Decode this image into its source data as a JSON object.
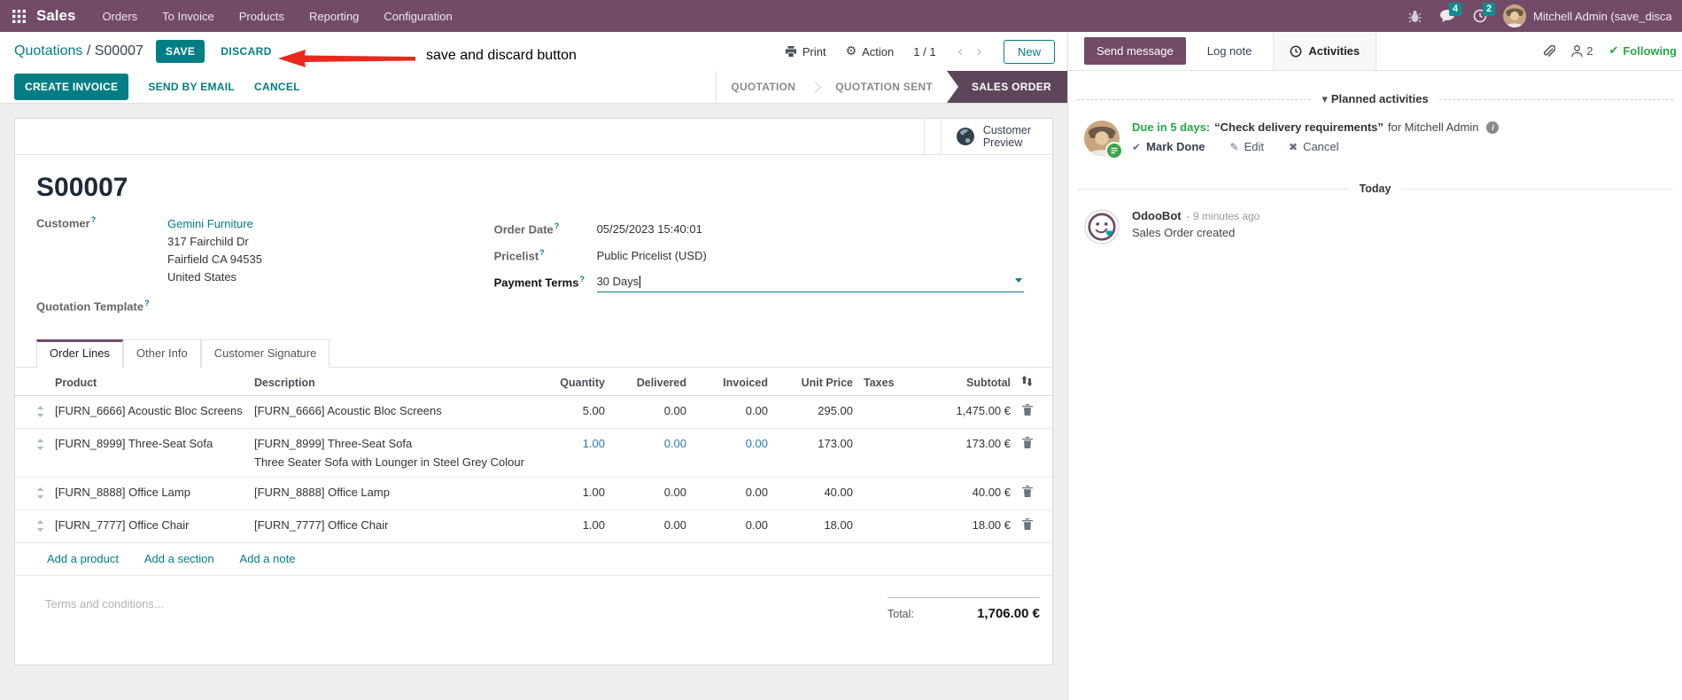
{
  "topbar": {
    "app_name": "Sales",
    "menus": [
      "Orders",
      "To Invoice",
      "Products",
      "Reporting",
      "Configuration"
    ],
    "messages_badge": "4",
    "activities_badge": "2",
    "user_name": "Mitchell Admin (save_discar"
  },
  "breadcrumb": {
    "parent": "Quotations",
    "separator": " / ",
    "current": "S00007",
    "save_label": "SAVE",
    "discard_label": "DISCARD",
    "print_label": "Print",
    "action_label": "Action",
    "pager": "1 / 1",
    "new_label": "New"
  },
  "annotation": {
    "text": "save and discard button"
  },
  "statusbar": {
    "buttons": [
      "CREATE INVOICE",
      "SEND BY EMAIL",
      "CANCEL"
    ],
    "states": [
      "QUOTATION",
      "QUOTATION SENT"
    ],
    "active_state": "SALES ORDER"
  },
  "form": {
    "customer_preview_line1": "Customer",
    "customer_preview_line2": "Preview",
    "title": "S00007",
    "customer_label": "Customer",
    "customer_name": "Gemini Furniture",
    "address": [
      "317 Fairchild Dr",
      "Fairfield CA 94535",
      "United States"
    ],
    "quotation_template_label": "Quotation Template",
    "order_date_label": "Order Date",
    "order_date": "05/25/2023 15:40:01",
    "pricelist_label": "Pricelist",
    "pricelist": "Public Pricelist (USD)",
    "payment_terms_label": "Payment Terms",
    "payment_terms": "30 Days",
    "tabs": [
      "Order Lines",
      "Other Info",
      "Customer Signature"
    ],
    "order_lines": {
      "columns": [
        "Product",
        "Description",
        "Quantity",
        "Delivered",
        "Invoiced",
        "Unit Price",
        "Taxes",
        "Subtotal"
      ],
      "rows": [
        {
          "product": "[FURN_6666] Acoustic Bloc Screens",
          "description": "[FURN_6666] Acoustic Bloc Screens",
          "description2": "",
          "quantity": "5.00",
          "delivered": "0.00",
          "invoiced": "0.00",
          "unit_price": "295.00",
          "taxes": "",
          "subtotal": "1,475.00 €"
        },
        {
          "product": "[FURN_8999] Three-Seat Sofa",
          "description": "[FURN_8999] Three-Seat Sofa",
          "description2": "Three Seater Sofa with Lounger in Steel Grey Colour",
          "quantity": "1.00",
          "delivered": "0.00",
          "invoiced": "0.00",
          "unit_price": "173.00",
          "taxes": "",
          "subtotal": "173.00 €"
        },
        {
          "product": "[FURN_8888] Office Lamp",
          "description": "[FURN_8888] Office Lamp",
          "description2": "",
          "quantity": "1.00",
          "delivered": "0.00",
          "invoiced": "0.00",
          "unit_price": "40.00",
          "taxes": "",
          "subtotal": "40.00 €"
        },
        {
          "product": "[FURN_7777] Office Chair",
          "description": "[FURN_7777] Office Chair",
          "description2": "",
          "quantity": "1.00",
          "delivered": "0.00",
          "invoiced": "0.00",
          "unit_price": "18.00",
          "taxes": "",
          "subtotal": "18.00 €"
        }
      ],
      "footer_links": [
        "Add a product",
        "Add a section",
        "Add a note"
      ]
    },
    "terms_placeholder": "Terms and conditions...",
    "total_label": "Total:",
    "total_value": "1,706.00 €"
  },
  "chatter": {
    "send_message_label": "Send message",
    "log_note_label": "Log note",
    "activities_label": "Activities",
    "followers_count": "2",
    "following_label": "Following",
    "planned_title": "Planned activities",
    "activity": {
      "due": "Due in 5 days:",
      "summary": "“Check delivery requirements”",
      "for_text": "for Mitchell Admin",
      "mark_done_label": "Mark Done",
      "edit_label": "Edit",
      "cancel_label": "Cancel"
    },
    "today_label": "Today",
    "message": {
      "author": "OdooBot",
      "time": "- 9 minutes ago",
      "body": "Sales Order created"
    }
  },
  "icons": {
    "help": "?",
    "gear": "⚙",
    "chevron_left": "‹",
    "chevron_right": "›",
    "caret_down": "▾",
    "check": "✔",
    "pencil": "✎",
    "cross": "✖",
    "info": "i"
  },
  "colors": {
    "brand": "#714B67",
    "primary": "#017E84",
    "active_state_bg": "#5E465A",
    "modified_value": "#2C78B3",
    "success": "#28a745"
  }
}
